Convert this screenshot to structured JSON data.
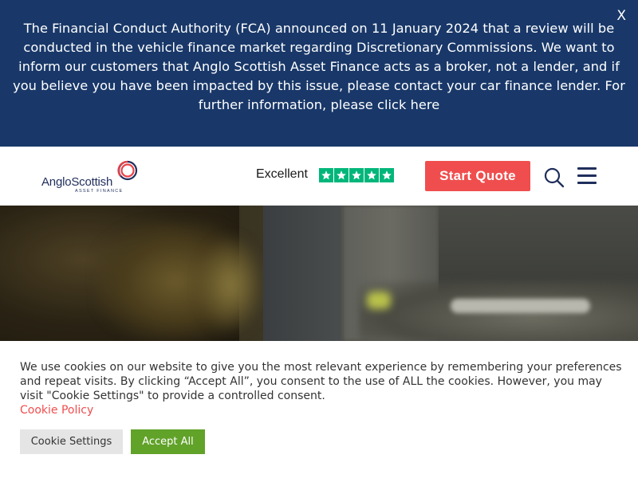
{
  "banner": {
    "text": "The Financial Conduct Authority (FCA) announced on 11 January 2024 that a review will be conducted in the vehicle finance market regarding Discretionary Commissions. We want to inform our customers that Anglo Scottish Asset Finance acts as a broker, not a lender, and if you believe you have been impacted by this issue, please contact your car finance lender. For further information, please click here",
    "close_label": "X",
    "background_color": "#193869"
  },
  "header": {
    "logo_text": "AngloScottish",
    "logo_subtext": "ASSET FINANCE",
    "trustpilot_rating_label": "Excellent",
    "trustpilot_stars": 5,
    "cta_label": "Start Quote",
    "cta_color": "#f04e4e",
    "search_icon": "search-icon",
    "menu_icon": "hamburger-menu-icon"
  },
  "cookie": {
    "message": "We use cookies on our website to give you the most relevant experience by remembering your preferences and repeat visits. By clicking “Accept All”, you consent to the use of ALL the cookies. However, you may visit \"Cookie Settings\" to provide a controlled consent.",
    "policy_link": "Cookie Policy",
    "settings_label": "Cookie Settings",
    "accept_label": "Accept All",
    "accept_color": "#61a229",
    "link_color": "#f04e4e"
  }
}
